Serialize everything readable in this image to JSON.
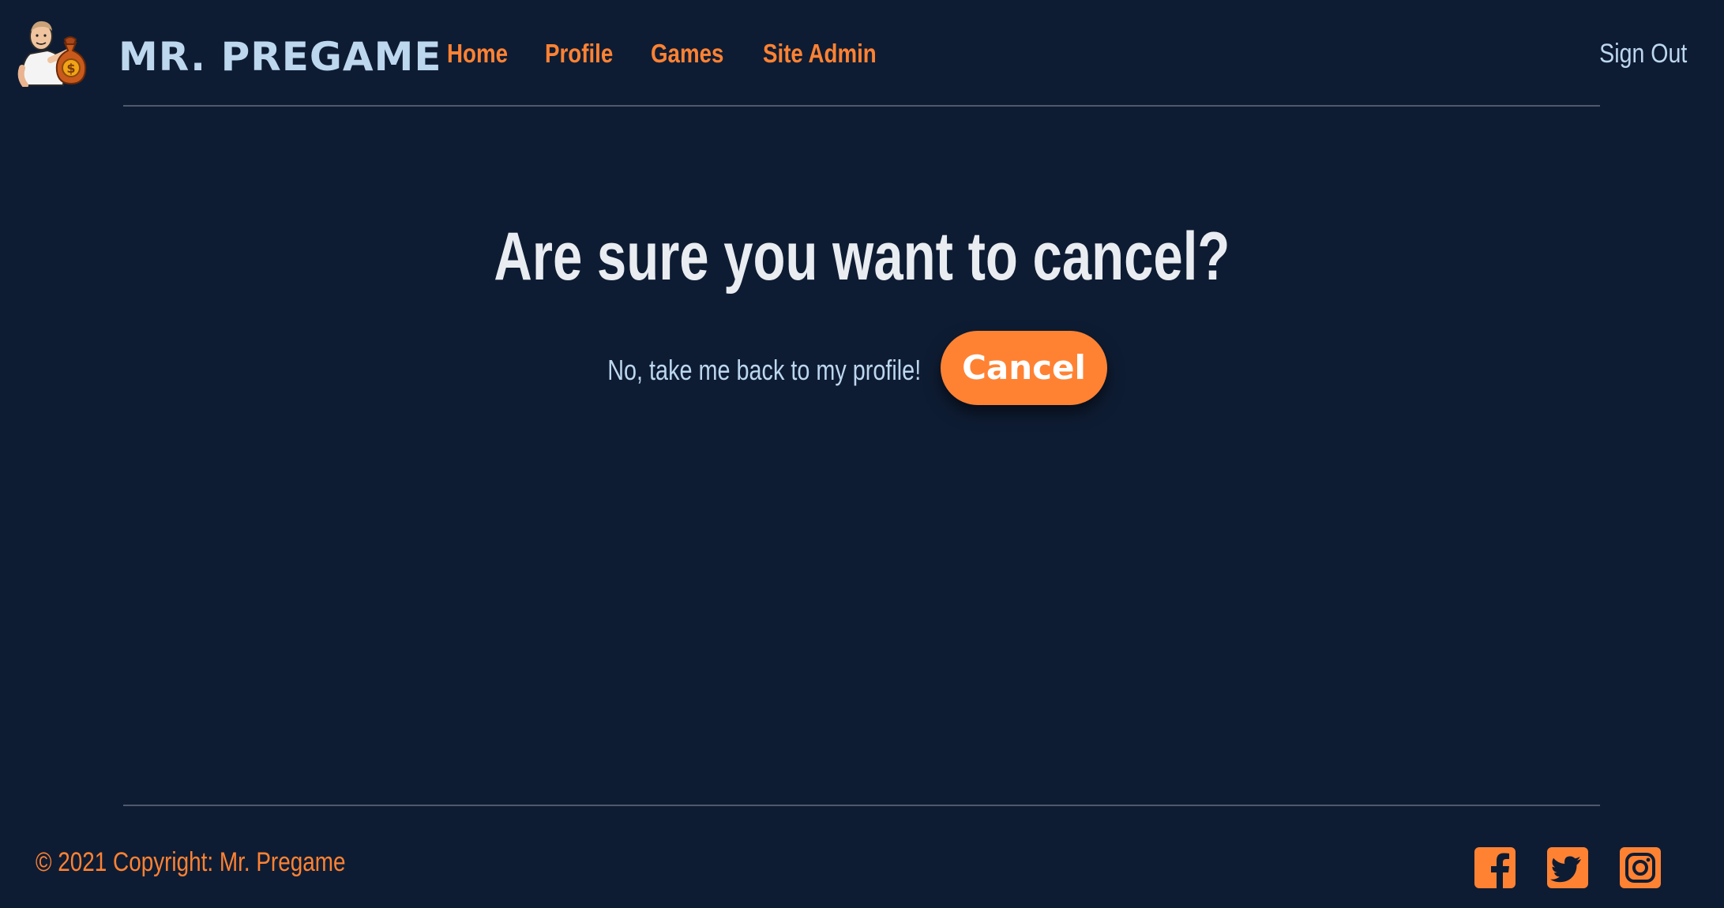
{
  "header": {
    "brand": "MR. PREGAME",
    "logo_icon": "mascot-money-bag-icon",
    "nav": [
      {
        "label": "Home"
      },
      {
        "label": "Profile"
      },
      {
        "label": "Games"
      },
      {
        "label": "Site Admin"
      }
    ],
    "sign_out": "Sign Out"
  },
  "main": {
    "title": "Are sure you want to cancel?",
    "back_link": "No, take me back to my profile!",
    "cancel_button": "Cancel"
  },
  "footer": {
    "copyright": "© 2021 Copyright: Mr. Pregame",
    "social": [
      {
        "icon": "facebook-icon"
      },
      {
        "icon": "twitter-icon"
      },
      {
        "icon": "instagram-icon"
      }
    ]
  },
  "colors": {
    "background": "#0e1c33",
    "accent": "#ff8233",
    "brand_text": "#bcd7ee",
    "title_text": "#e9edf2",
    "divider": "#4e5a6b"
  }
}
